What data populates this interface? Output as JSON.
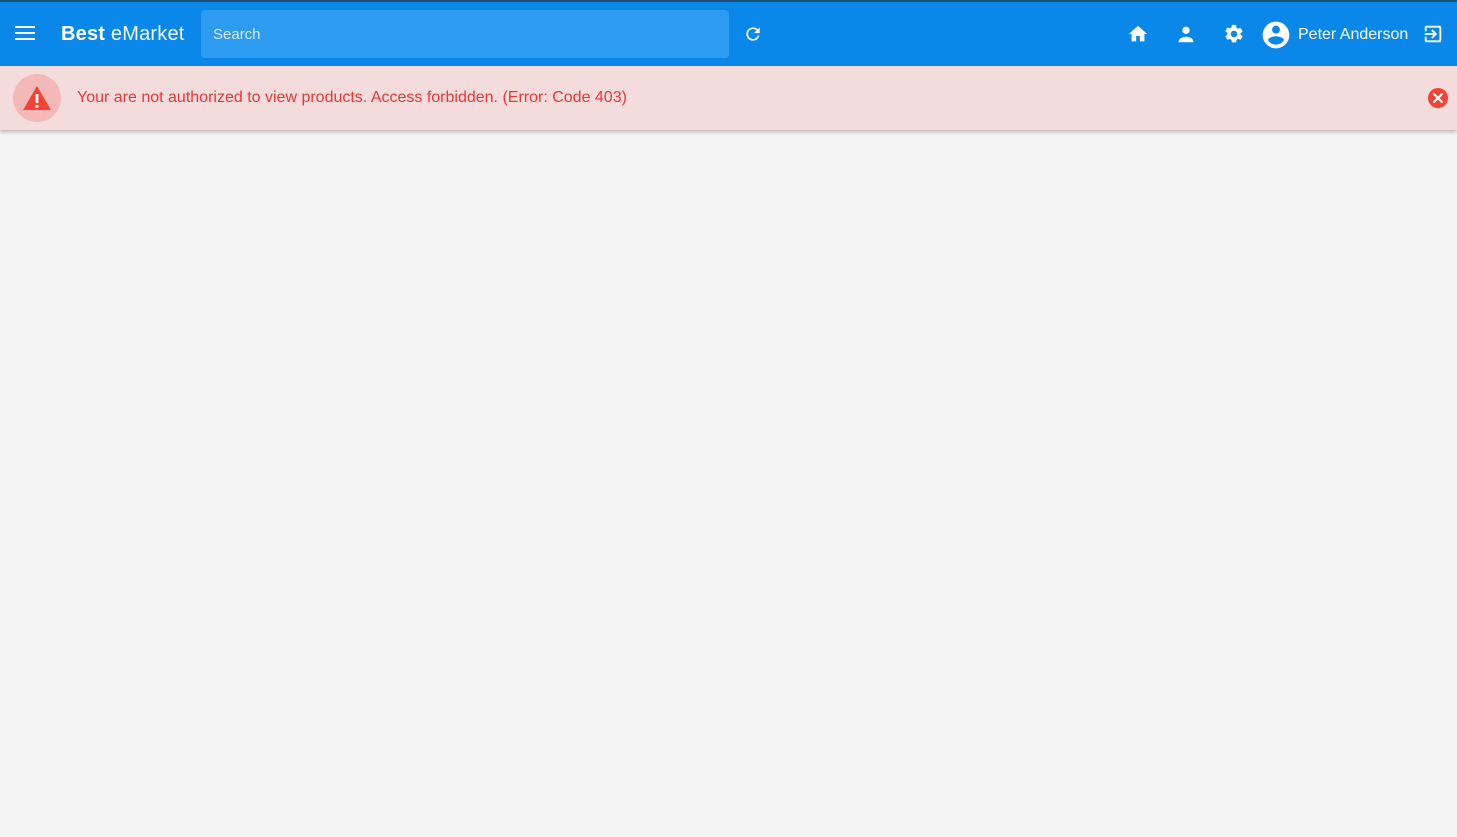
{
  "header": {
    "brand_bold": "Best",
    "brand_light": " eMarket",
    "search_placeholder": "Search",
    "user_name": "Peter Anderson",
    "icons": {
      "menu": "menu-icon",
      "refresh": "refresh-icon",
      "home": "home-icon",
      "person": "person-icon",
      "settings": "gear-icon",
      "avatar": "account-circle-icon",
      "logout": "logout-icon"
    },
    "colors": {
      "bar": "#0a88ea",
      "search_bg": "#2d9cf0"
    }
  },
  "alert": {
    "message": "Your are not authorized to view products. Access forbidden. (Error: Code 403)",
    "icons": {
      "warning": "warning-icon",
      "close": "close-circle-icon"
    },
    "colors": {
      "bg": "#f5dcdc",
      "text": "#e53935",
      "icon": "#f44336"
    }
  }
}
